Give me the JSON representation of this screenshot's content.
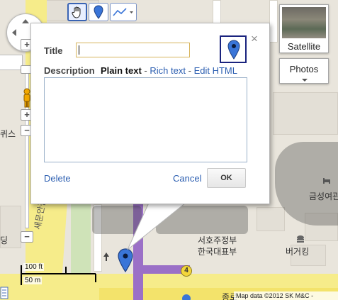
{
  "map": {
    "labels": {
      "top_left_partial": "문역",
      "left_partial": "퀴스",
      "bottom_left_partial": "딩",
      "vertical_road": "새문안길",
      "building_1_line1": "서호주정부",
      "building_1_line2": "한국대표부",
      "building_2": "금성여관",
      "building_3": "버거킹",
      "bottom_road_partial": "종로"
    },
    "route_badge": "4",
    "scale": {
      "imperial": "100 ft",
      "metric": "50 m"
    },
    "attribution": "Map data ©2012 SK M&C -"
  },
  "toolbar": {
    "tools": [
      {
        "name": "hand-icon",
        "active": true
      },
      {
        "name": "marker-icon",
        "active": false
      },
      {
        "name": "polyline-icon",
        "active": false
      }
    ]
  },
  "controls": {
    "satellite_label": "Satellite",
    "photos_label": "Photos"
  },
  "info_window": {
    "title_label": "Title",
    "title_value": "",
    "description_label": "Description",
    "modes": [
      "Plain text",
      "Rich text",
      "Edit HTML"
    ],
    "mode_separator": "-",
    "description_value": "",
    "delete_label": "Delete",
    "cancel_label": "Cancel",
    "ok_label": "OK",
    "close_glyph": "×"
  },
  "colors": {
    "map_bg": "#e9e5dc",
    "road_yellow": "#f6ec8a",
    "road_purple": "#9b70c7",
    "link_blue": "#2a5db0",
    "marker_blue": "#3a75d8"
  }
}
